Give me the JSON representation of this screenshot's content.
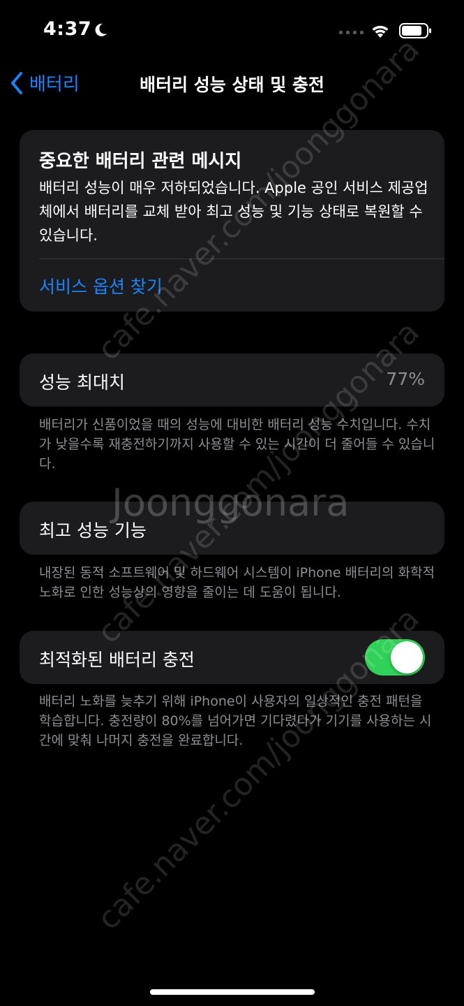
{
  "status_bar": {
    "time": "4:37"
  },
  "nav": {
    "back_label": "배터리",
    "title": "배터리 성능 상태 및 충전"
  },
  "message_card": {
    "title": "중요한 배터리 관련 메시지",
    "body": "배터리 성능이 매우 저하되었습니다. Apple 공인 서비스 제공업체에서 배터리를 교체 받아 최고 성능 및 기능 상태로 복원할 수 있습니다.",
    "link": "서비스 옵션 찾기"
  },
  "max_capacity": {
    "label": "성능 최대치",
    "value": "77%",
    "footnote": "배터리가 신품이었을 때의 성능에 대비한 배터리 성능 수치입니다. 수치가 낮을수록 재충전하기까지 사용할 수 있는 시간이 더 줄어들 수 있습니다."
  },
  "peak_performance": {
    "label": "최고 성능 기능",
    "footnote": "내장된 동적 소프트웨어 및 하드웨어 시스템이 iPhone 배터리의 화학적 노화로 인한 성능상의 영향을 줄이는 데 도움이 됩니다."
  },
  "optimized_charging": {
    "label": "최적화된 배터리 충전",
    "enabled": true,
    "footnote": "배터리 노화를 늦추기 위해 iPhone이 사용자의 일상적인 충전 패턴을 학습합니다. 충전량이 80%를 넘어가면 기다렸다가 기기를 사용하는 시간에 맞춰 나머지 충전을 완료합니다."
  },
  "watermark": {
    "url": "cafe.naver.com/joonggonara",
    "brand": "Joonggonara"
  },
  "colors": {
    "accent": "#1a84ff",
    "toggle_on": "#30d158",
    "card": "#1c1c1e",
    "secondary_text": "#8e8e93"
  },
  "icons": [
    "moon-icon",
    "signal-icon",
    "wifi-icon",
    "battery-icon",
    "chevron-left-icon"
  ]
}
